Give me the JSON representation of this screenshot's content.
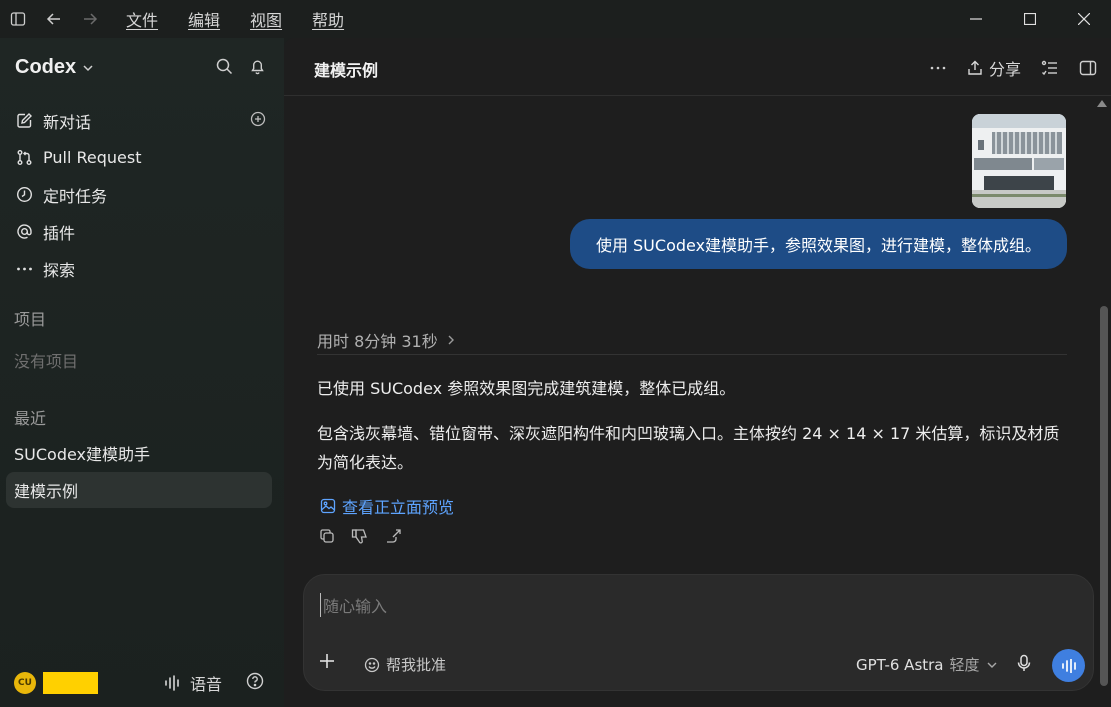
{
  "menu": [
    "文件",
    "编辑",
    "视图",
    "帮助"
  ],
  "sidebar": {
    "brand": "Codex",
    "nav": [
      {
        "label": "新对话",
        "icon": "edit-icon"
      },
      {
        "label": "Pull Request",
        "icon": "git-pull-request-icon"
      },
      {
        "label": "定时任务",
        "icon": "clock-icon"
      },
      {
        "label": "插件",
        "icon": "at-icon"
      },
      {
        "label": "探索",
        "icon": "more-icon"
      }
    ],
    "projects_heading": "项目",
    "projects_empty": "没有项目",
    "recent_heading": "最近",
    "recent": [
      {
        "label": "SUCodex建模助手"
      },
      {
        "label": "建模示例"
      }
    ],
    "user_initials": "CU",
    "voice_label": "语音"
  },
  "main": {
    "title": "建模示例",
    "share_label": "分享",
    "user_message": "使用 SUCodex建模助手，参照效果图，进行建模，整体成组。",
    "elapsed": "用时 8分钟 31秒",
    "reply": [
      "已使用 SUCodex 参照效果图完成建筑建模，整体已成组。",
      "包含浅灰幕墙、错位窗带、深灰遮阳构件和内凹玻璃入口。主体按约 24 × 14 × 17 米估算，标识及材质为简化表达。"
    ],
    "preview_link": "查看正立面预览"
  },
  "composer": {
    "placeholder": "随心输入",
    "critique_label": "帮我批准",
    "model": "GPT-6 Astra",
    "effort": "轻度"
  },
  "colors": {
    "accent": "#3f7fe0",
    "user_bubble": "#1e4c86",
    "link": "#5ea4ff",
    "avatar": "#e9b70a"
  }
}
